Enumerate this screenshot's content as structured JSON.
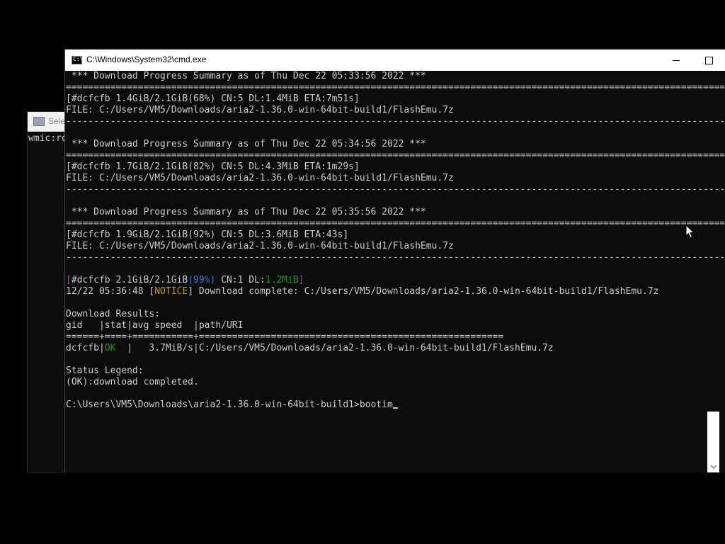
{
  "background_window": {
    "title": "Sele",
    "console_line": "wmic:ro"
  },
  "window": {
    "title": "C:\\Windows\\System32\\cmd.exe",
    "icon": "cmd-icon",
    "icon_glyph": "C:\\",
    "controls": [
      "minimize-icon",
      "maximize-icon"
    ]
  },
  "console": {
    "summary_1": {
      "header": " *** Download Progress Summary as of Thu Dec 22 05:33:56 2022 ***",
      "sep": "==============================================================================================================================",
      "progress": "[#dcfcfb 1.4GiB/2.1GiB(68%) CN:5 DL:1.4MiB ETA:7m51s]",
      "file": "FILE: C:/Users/VM5/Downloads/aria2-1.36.0-win-64bit-build1/FlashEmu.7z",
      "dash": "------------------------------------------------------------------------------------------------------------------------------"
    },
    "summary_2": {
      "header": " *** Download Progress Summary as of Thu Dec 22 05:34:56 2022 ***",
      "sep": "==============================================================================================================================",
      "progress": "[#dcfcfb 1.7GiB/2.1GiB(82%) CN:5 DL:4.3MiB ETA:1m29s]",
      "file": "FILE: C:/Users/VM5/Downloads/aria2-1.36.0-win-64bit-build1/FlashEmu.7z",
      "dash": "------------------------------------------------------------------------------------------------------------------------------"
    },
    "summary_3": {
      "header": " *** Download Progress Summary as of Thu Dec 22 05:35:56 2022 ***",
      "sep": "==============================================================================================================================",
      "progress": "[#dcfcfb 1.9GiB/2.1GiB(92%) CN:5 DL:3.6MiB ETA:43s]",
      "file": "FILE: C:/Users/VM5/Downloads/aria2-1.36.0-win-64bit-build1/FlashEmu.7z",
      "dash": "------------------------------------------------------------------------------------------------------------------------------"
    },
    "final_progress": {
      "open": "[",
      "gid": "#dcfcfb 2.1GiB/2.1GiB",
      "pct": "(99%)",
      "mid": " CN:1 DL:",
      "speed": "1.2MiB",
      "close": "]"
    },
    "notice": {
      "time": "12/22 05:36:48 [",
      "tag": "NOTICE",
      "text": "] Download complete: C:/Users/VM5/Downloads/aria2-1.36.0-win-64bit-build1/FlashEmu.7z"
    },
    "results_title": "Download Results:",
    "results_header": "gid   |stat|avg speed  |path/URI",
    "results_sep": "======+====+===========+=======================================================",
    "result_row": {
      "gid": "dcfcfb|",
      "stat": "OK",
      "rest": "  |   3.7MiB/s|C:/Users/VM5/Downloads/aria2-1.36.0-win-64bit-build1/FlashEmu.7z"
    },
    "legend_title": "Status Legend:",
    "legend_line": "(OK):download completed.",
    "prompt": "C:\\Users\\VM5\\Downloads\\aria2-1.36.0-win-64bit-build1>",
    "input": "bootim"
  },
  "colors": {
    "console_bg": "#0c0c0c",
    "console_fg": "#cccccc",
    "magenta": "#a84c9c",
    "blue": "#3b78d8",
    "green": "#13a10e",
    "yellow": "#c19c00"
  }
}
